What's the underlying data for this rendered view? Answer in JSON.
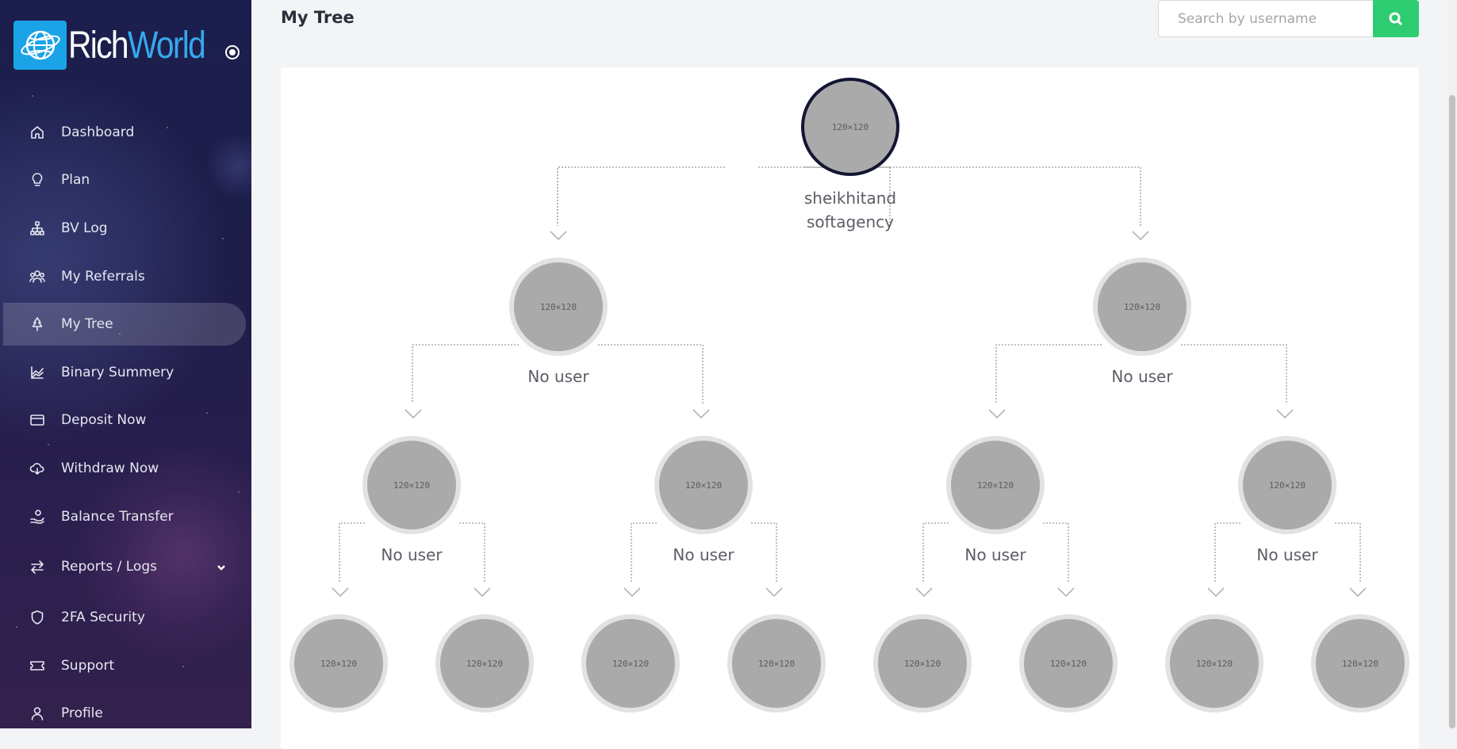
{
  "brand": {
    "name_part1": "Rich",
    "name_part2": "World"
  },
  "page": {
    "title": "My Tree"
  },
  "search": {
    "placeholder": "Search by username",
    "value": ""
  },
  "sidebar": {
    "items": [
      {
        "label": "Dashboard",
        "icon": "home-icon"
      },
      {
        "label": "Plan",
        "icon": "lightbulb-icon"
      },
      {
        "label": "BV Log",
        "icon": "sitemap-icon"
      },
      {
        "label": "My Referrals",
        "icon": "users-icon"
      },
      {
        "label": "My Tree",
        "icon": "tree-icon",
        "active": true
      },
      {
        "label": "Binary Summery",
        "icon": "chart-icon"
      },
      {
        "label": "Deposit Now",
        "icon": "card-icon"
      },
      {
        "label": "Withdraw Now",
        "icon": "cloud-download-icon"
      },
      {
        "label": "Balance Transfer",
        "icon": "hand-coin-icon"
      },
      {
        "label": "Reports / Logs",
        "icon": "arrows-exchange-icon",
        "has_submenu": true
      },
      {
        "label": "2FA Security",
        "icon": "shield-icon"
      },
      {
        "label": "Support",
        "icon": "ticket-icon"
      },
      {
        "label": "Profile",
        "icon": "user-icon"
      }
    ]
  },
  "tree": {
    "placeholder_text": "120×120",
    "root": {
      "line1": "sheikhitand",
      "line2": "softagency"
    },
    "level1": [
      {
        "label": "No user"
      },
      {
        "label": "No user"
      }
    ],
    "level2": [
      {
        "label": "No user"
      },
      {
        "label": "No user"
      },
      {
        "label": "No user"
      },
      {
        "label": "No user"
      }
    ],
    "level3_count": 8
  },
  "colors": {
    "sidebar_bg": "#1c1f4d",
    "accent_search": "#2ecc71",
    "logo_badge": "#1aa3e6",
    "root_ring": "#121633"
  }
}
